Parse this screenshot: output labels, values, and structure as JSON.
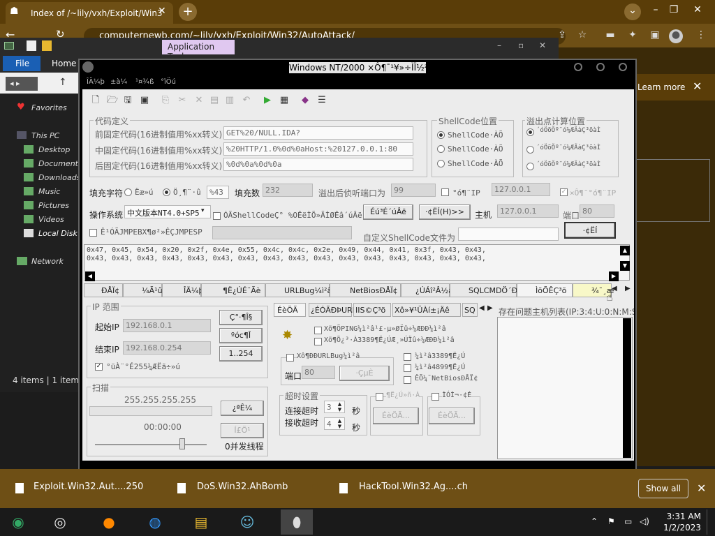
{
  "browser": {
    "tab_title": "Index of /~lily/vxh/Exploit/Win3",
    "url": "computernewb.com/~lily/vxh/Exploit/Win32/AutoAttack/",
    "learn_more": "Learn more"
  },
  "explorer": {
    "app_tools": "Application Tools",
    "file_tab": "File",
    "home_tab": "Home",
    "nav_items": [
      "Favorites",
      "This PC",
      "Desktop",
      "Documents",
      "Downloads",
      "Music",
      "Pictures",
      "Videos",
      "Local Disk (",
      "Network"
    ],
    "status": "4 items   |   1 item"
  },
  "app": {
    "title": "Windows NT/2000 ×Ô¶¯¹¥»÷ÌÏ½²â»ú",
    "menu": [
      "ÎÄ¼þ",
      "±à¼­",
      "¹¤¾ß",
      "°ïÖú"
    ],
    "code_def_group": "代码定义",
    "prefix_label": "前固定代码(16进制值用%xx转义)",
    "prefix_value": "GET%20/NULL.IDA?",
    "middle_label": "中固定代码(16进制值用%xx转义)",
    "middle_value": "%20HTTP/1.0%0d%0aHost:%20127.0.0.1:80",
    "suffix_label": "后固定代码(16进制值用%xx转义)",
    "suffix_value": "%0d%0a%0d%0a",
    "shellcode_group": "ShellCode位置",
    "shellcode_opts": [
      "ShellCode·ÀÕ",
      "ShellCode·ÀÕ",
      "ShellCode·ÀÕ"
    ],
    "overflow_group": "溢出点计算位置",
    "overflow_opts": [
      "´óÖõÕº¯ó¼ÆÃàÇ³õàÌ",
      "´óÖõÕº¯ó¼ÆÃàÇ³õàÌ",
      "´óÖõÕº¯ó¼ÆÃàÇ³õàÌ"
    ],
    "fill_char_label": "填充字符",
    "fill_opt1": "Ëæ»ú",
    "fill_opt2": "Ö¸¶¨·û",
    "fill_char_value": "%43",
    "fill_count_label": "填充数",
    "fill_count_value": "232",
    "listen_port_label": "溢出后侦听端口为",
    "listen_port_value": "99",
    "ip_check_label": "°ó¶¨IP",
    "ip_check_value": "127.0.0.1",
    "auto_ip_label": "×Ô¶¯°ó¶¨IP",
    "os_label": "操作系统",
    "os_value": "中文版本NT4.0+SP5",
    "use_shellcode_label": "ÓÃShellCodeÇ° %OÊëÌÕ»ÃÌØÊâ´úÂë",
    "btn_encode": "Éú³É´úÂë",
    "btn_view": "·¢ËÍ(H)>>",
    "host_label": "主机",
    "host_value": "127.0.0.1",
    "port_label": "端口",
    "port_value": "80",
    "jmp_label": "Ê¹ÓÃJMPEBX¶ø²»ÊÇJMPESP",
    "custom_sc_label": "自定义ShellCode文件为",
    "btn_attack": "·¢ËÍ",
    "hex_line1": "0x47, 0x45, 0x54, 0x20, 0x2f, 0x4e, 0x55, 0x4c, 0x4c, 0x2e, 0x49, 0x44, 0x41, 0x3f, 0x43, 0x43,",
    "hex_line2": "0x43, 0x43, 0x43, 0x43, 0x43, 0x43, 0x43, 0x43, 0x43, 0x43, 0x43, 0x43, 0x43, 0x43, 0x43, 0x43,",
    "tools_tabs": [
      "ÐÅÏ¢",
      "¼Ã¹û",
      "ÎÄ¼þ",
      "¶Ë¿ÚÉ¨Ãè",
      "URLBug¼ì²â",
      "NetBiosÐÅÏ¢",
      "¿ÚÁî²Â½â",
      "SQLCMDÖ´ÐÐ",
      "ÌõÕÊÇ³õ",
      "¾¯¸æ"
    ],
    "ip_range_group": "IP 范围",
    "start_ip_label": "起始IP",
    "start_ip_value": "192.168.0.1",
    "end_ip_label": "结束IP",
    "end_ip_value": "192.168.0.254",
    "btn_c_class": "Ç°·¶Î§",
    "btn_b_class": "ºóc¶Î",
    "btn_range": "1..254",
    "check_255": "°üÀ¨°É255¼ÆËã÷»ú",
    "scan_group": "扫描",
    "scan_ip": "255.255.255.255",
    "scan_time": "00:00:00",
    "btn_start": "¿ªÊ¼",
    "btn_stop": "Í£Ö¹",
    "threads_label": "0并发线程",
    "inner_tabs": [
      "ÉèÖÃ",
      "¿ÉÓÃÐÞURL",
      "IIS©Ç³ö",
      "Xô»¥¹ÜÀí±¡Äê",
      "SQ"
    ],
    "opt1": "Xö¶ÕPING¼ì²â¹£·µ»ØÏû÷¼ÆÐÐ¼ì²â",
    "opt2": "Xö¶Õ¿³·À3389¶Ë¿ÚÆ¸»ÚÏû÷¼ÆÐÐ¼ì²â",
    "url_bug_label": "Xô¶ÐÐURLBug¼ì²â",
    "port2_label": "端口",
    "port2_value": "80",
    "btn_url": "·ÇµÈ",
    "chk_3389": "¼ì²â3389¶Ë¿Ú",
    "chk_4899": "¼ì²â4899¶Ë¿Ú",
    "chk_netbios": "ÊÕ¼¯NetBiosÐÅÏ¢",
    "timeout_group": "超时设置",
    "connect_timeout_label": "连接超时",
    "connect_timeout_value": "3",
    "recv_timeout_label": "接收超时",
    "recv_timeout_value": "4",
    "seconds": "秒",
    "chk_a": "¶Ë¿Ú»ñ·À",
    "chk_b": "ÌÓÌ¬·¢É",
    "btn_set1": "ÉèÖÃ...",
    "btn_set2": "ÉèÖÃ...",
    "hosts_list_label": "存在问题主机列表(IP:3:4:U:0:N:M:S)"
  },
  "downloads": {
    "items": [
      "Exploit.Win32.Aut....250",
      "DoS.Win32.AhBomb",
      "HackTool.Win32.Ag....ch"
    ],
    "show_all": "Show all"
  },
  "taskbar": {
    "time": "3:31 AM",
    "date": "1/2/2023"
  }
}
